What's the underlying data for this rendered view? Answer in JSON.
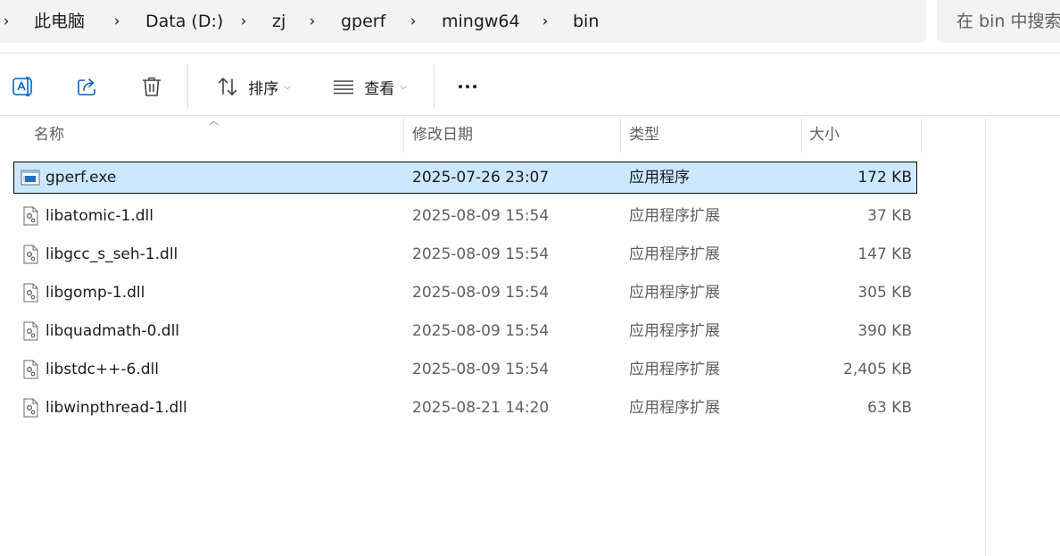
{
  "breadcrumb": {
    "items": [
      "此电脑",
      "Data (D:)",
      "zj",
      "gperf",
      "mingw64",
      "bin"
    ],
    "separator": "›"
  },
  "search": {
    "placeholder": "在 bin 中搜索"
  },
  "toolbar": {
    "rename_icon": "rename-icon",
    "share_icon": "share-icon",
    "delete_icon": "trash-icon",
    "sort_label": "排序",
    "view_label": "查看",
    "more_icon": "more-icon"
  },
  "columns": {
    "name": "名称",
    "modified": "修改日期",
    "type": "类型",
    "size": "大小"
  },
  "files": [
    {
      "name": "gperf.exe",
      "modified": "2025-07-26 23:07",
      "type": "应用程序",
      "size": "172 KB",
      "icon": "exe-icon",
      "selected": true
    },
    {
      "name": "libatomic-1.dll",
      "modified": "2025-08-09 15:54",
      "type": "应用程序扩展",
      "size": "37 KB",
      "icon": "dll-icon"
    },
    {
      "name": "libgcc_s_seh-1.dll",
      "modified": "2025-08-09 15:54",
      "type": "应用程序扩展",
      "size": "147 KB",
      "icon": "dll-icon"
    },
    {
      "name": "libgomp-1.dll",
      "modified": "2025-08-09 15:54",
      "type": "应用程序扩展",
      "size": "305 KB",
      "icon": "dll-icon"
    },
    {
      "name": "libquadmath-0.dll",
      "modified": "2025-08-09 15:54",
      "type": "应用程序扩展",
      "size": "390 KB",
      "icon": "dll-icon"
    },
    {
      "name": "libstdc++-6.dll",
      "modified": "2025-08-09 15:54",
      "type": "应用程序扩展",
      "size": "2,405 KB",
      "icon": "dll-icon"
    },
    {
      "name": "libwinpthread-1.dll",
      "modified": "2025-08-21 14:20",
      "type": "应用程序扩展",
      "size": "63 KB",
      "icon": "dll-icon"
    }
  ],
  "colors": {
    "selection": "#cce8ff",
    "accent": "#0067c0",
    "secondary_text": "#5f5f5f"
  }
}
